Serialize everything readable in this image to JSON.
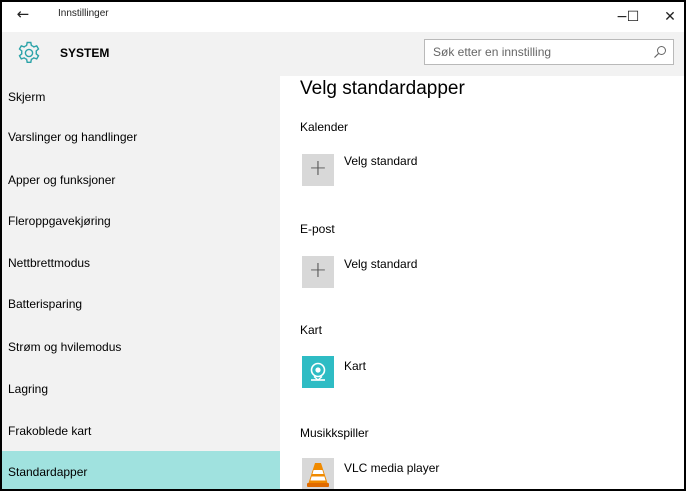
{
  "window": {
    "title": "Innstillinger",
    "back_glyph": "←",
    "minimize_glyph": "−",
    "maximize_glyph": "☐",
    "close_glyph": "✕"
  },
  "header": {
    "section": "SYSTEM",
    "search_placeholder": "Søk etter en innstilling",
    "accent_color": "#2ba3a8"
  },
  "sidebar": {
    "selected_color": "#a0e2df",
    "items": [
      {
        "label": "Skjerm"
      },
      {
        "label": "Varslinger og handlinger"
      },
      {
        "label": "Apper og funksjoner"
      },
      {
        "label": "Fleroppgavekjøring"
      },
      {
        "label": "Nettbrettmodus"
      },
      {
        "label": "Batterisparing"
      },
      {
        "label": "Strøm og hvilemodus"
      },
      {
        "label": "Lagring"
      },
      {
        "label": "Frakoblede kart"
      },
      {
        "label": "Standardapper",
        "selected": true
      }
    ]
  },
  "main": {
    "title": "Velg standardapper",
    "categories": [
      {
        "label": "Kalender",
        "app": "Velg standard",
        "icon": "plus-icon"
      },
      {
        "label": "E-post",
        "app": "Velg standard",
        "icon": "plus-icon"
      },
      {
        "label": "Kart",
        "app": "Kart",
        "icon": "maps-app-icon"
      },
      {
        "label": "Musikkspiller",
        "app": "VLC media player",
        "icon": "vlc-cone-icon"
      }
    ]
  }
}
